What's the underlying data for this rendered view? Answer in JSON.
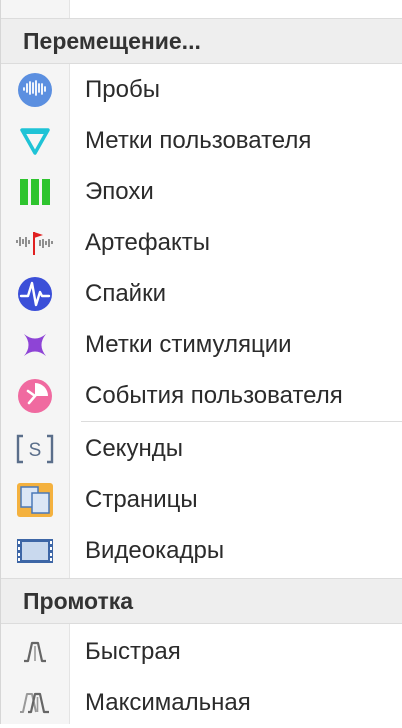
{
  "sections": [
    {
      "header": "Перемещение...",
      "items": [
        {
          "label": "Пробы",
          "icon": "probes-icon"
        },
        {
          "label": "Метки пользователя",
          "icon": "user-marks-icon"
        },
        {
          "label": "Эпохи",
          "icon": "epochs-icon"
        },
        {
          "label": "Артефакты",
          "icon": "artifacts-icon"
        },
        {
          "label": "Спайки",
          "icon": "spikes-icon"
        },
        {
          "label": "Метки стимуляции",
          "icon": "stimulation-marks-icon"
        },
        {
          "label": "События пользователя",
          "icon": "user-events-icon"
        },
        {
          "label": "Секунды",
          "icon": "seconds-icon"
        },
        {
          "label": "Страницы",
          "icon": "pages-icon"
        },
        {
          "label": "Видеокадры",
          "icon": "video-frames-icon"
        }
      ]
    },
    {
      "header": "Промотка",
      "items": [
        {
          "label": "Быстрая",
          "icon": "fast-scroll-icon"
        },
        {
          "label": "Максимальная",
          "icon": "max-scroll-icon"
        }
      ]
    }
  ],
  "colors": {
    "probes": "#5b8fe0",
    "user_marks": "#1fc3d6",
    "epochs": "#2ec42e",
    "artifacts_flag": "#e02020",
    "spikes": "#3b4fd8",
    "stimulation": "#8e44d6",
    "user_events": "#f06aa0",
    "pages": "#f4b13e"
  }
}
